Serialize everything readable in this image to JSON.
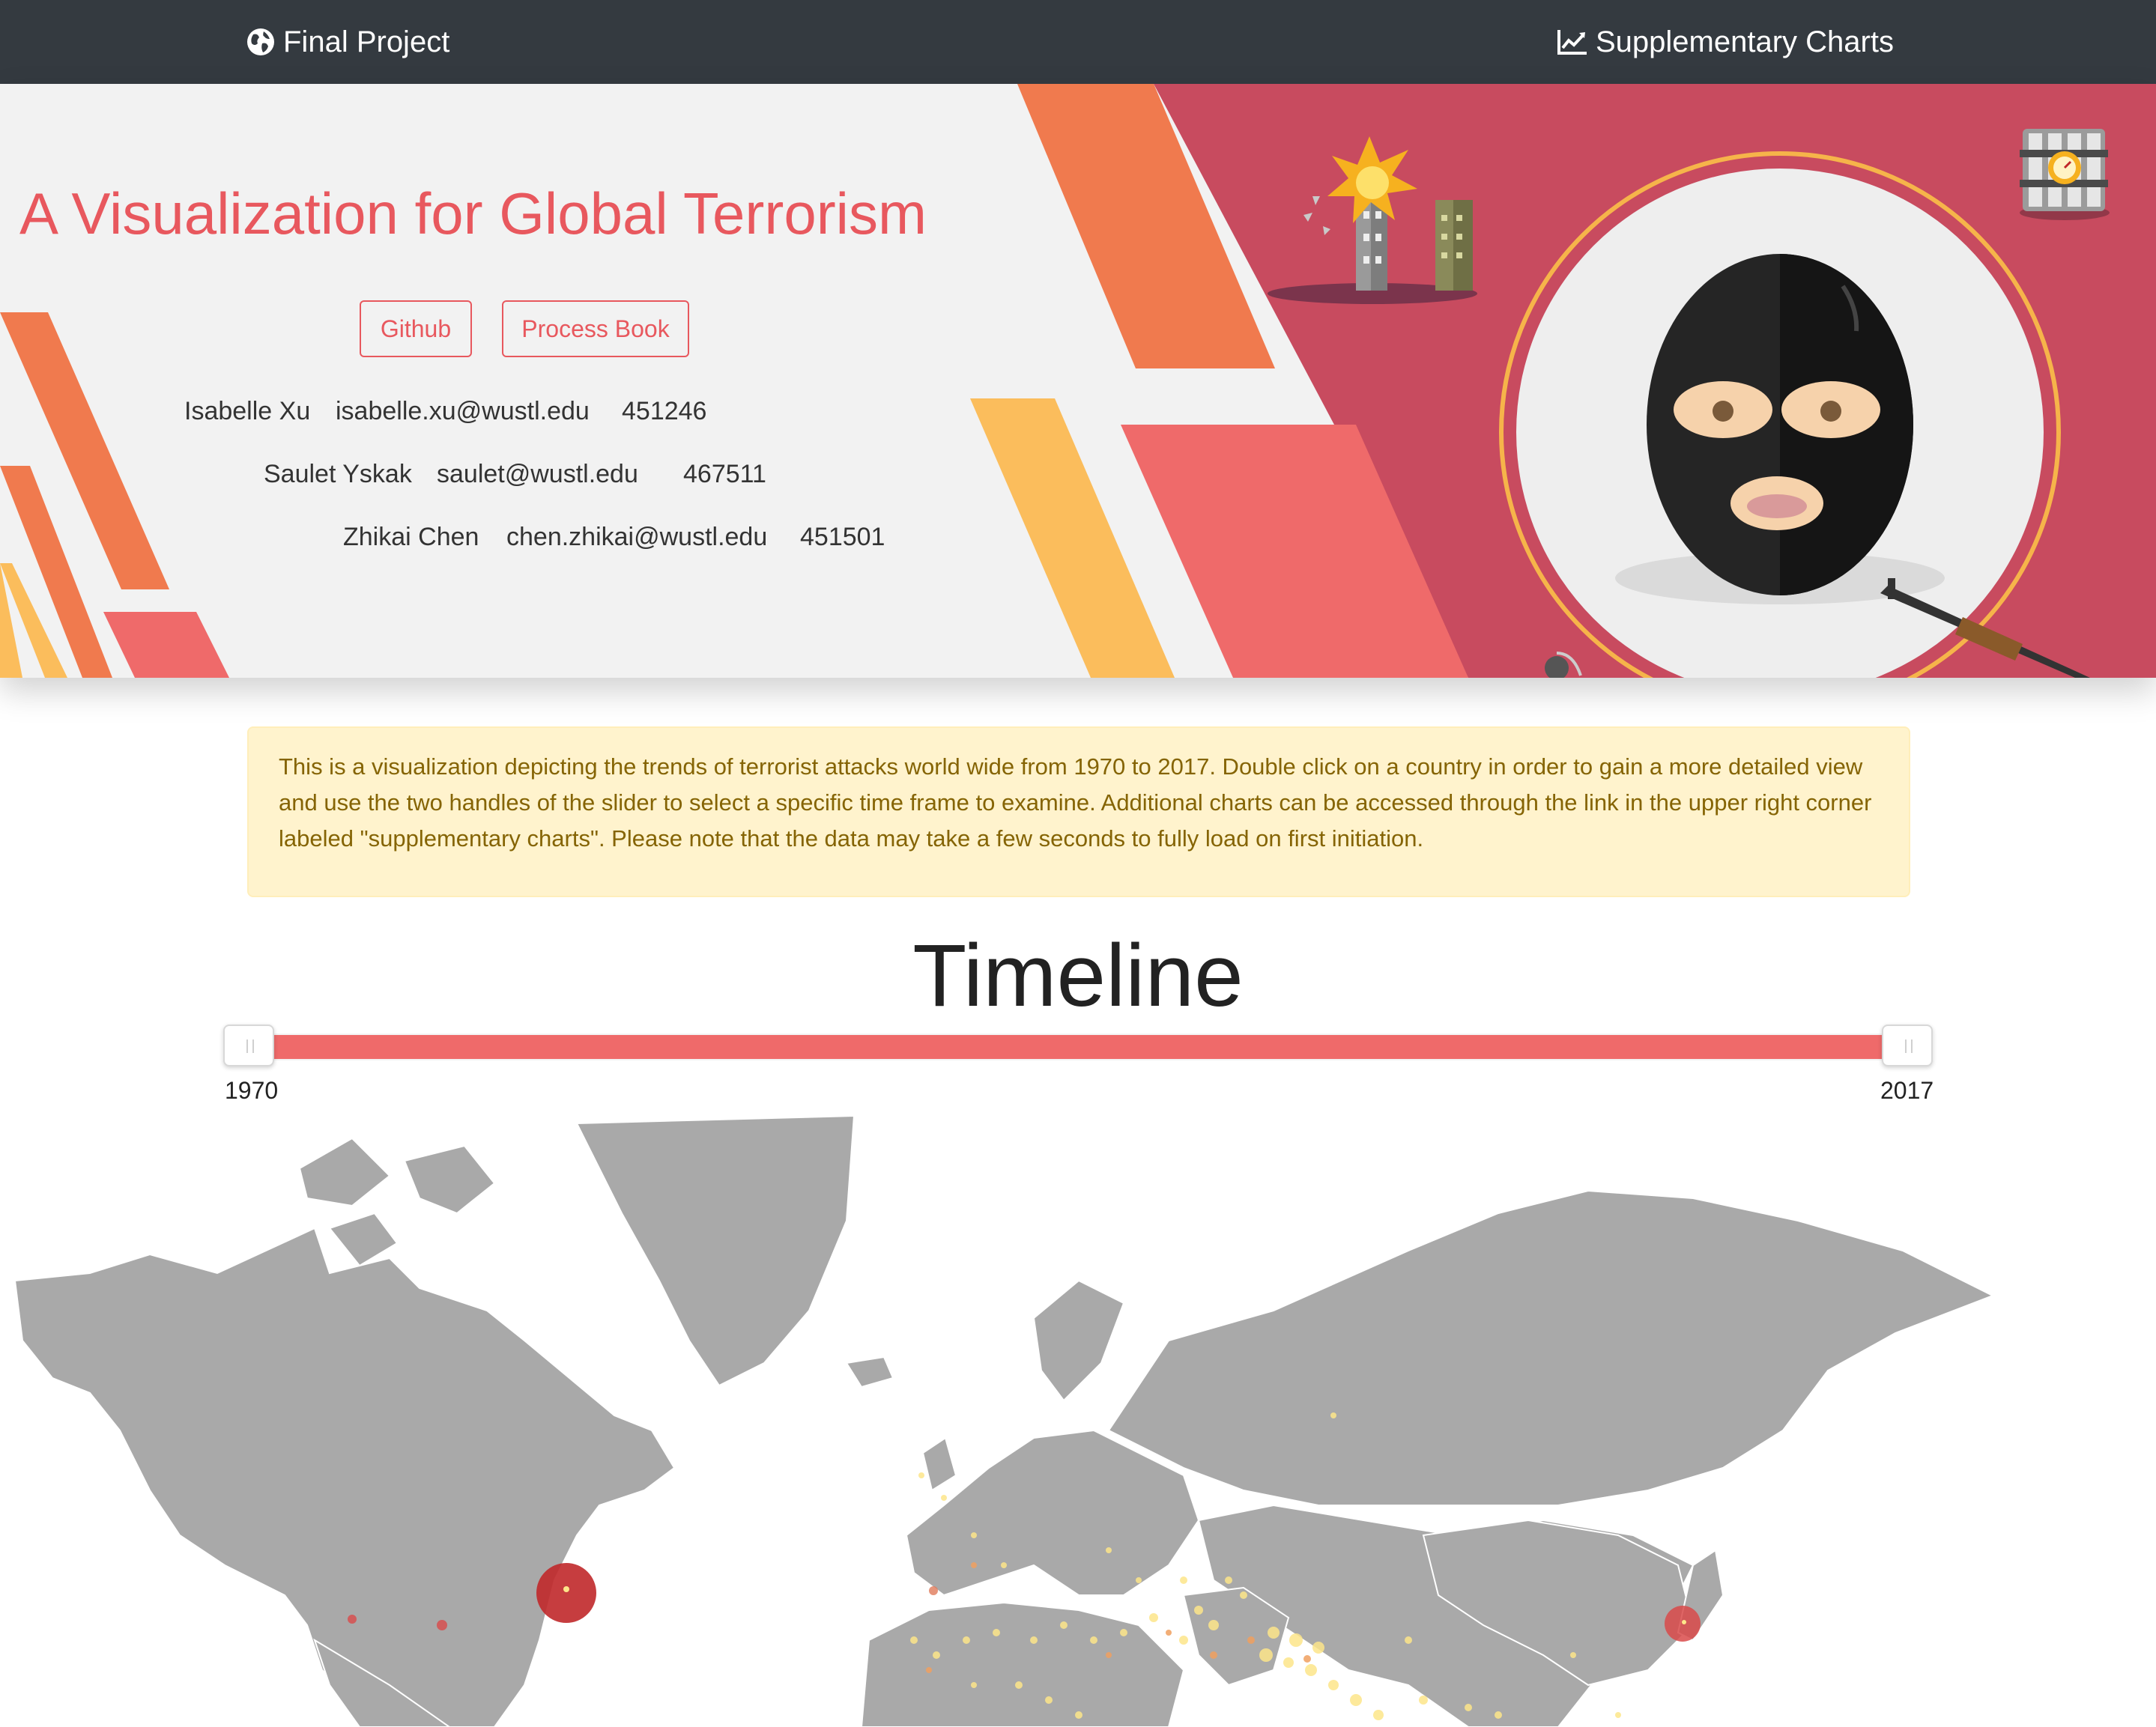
{
  "navbar": {
    "brand_label": "Final Project",
    "brand_icon": "globe-icon",
    "supplementary_label": "Supplementary Charts",
    "supplementary_icon": "line-chart-icon"
  },
  "hero": {
    "title": "A Visualization for Global Terrorism",
    "buttons": {
      "github": "Github",
      "process_book": "Process Book"
    },
    "authors": [
      {
        "name": "Isabelle Xu",
        "email": "isabelle.xu@wustl.edu",
        "id": "451246"
      },
      {
        "name": "Saulet Yskak",
        "email": "saulet@wustl.edu",
        "id": "467511"
      },
      {
        "name": "Zhikai Chen",
        "email": "chen.zhikai@wustl.edu",
        "id": "451501"
      }
    ]
  },
  "alert": {
    "text": "This is a visualization depicting the trends of terrorist attacks world wide from 1970 to 2017. Double click on a country in order to gain a more detailed view and use the two handles of the slider to select a specific time frame to examine. Additional charts can be accessed through the link in the upper right corner labeled \"supplementary charts\". Please note that the data may take a few seconds to fully load on first initiation."
  },
  "timeline": {
    "title": "Timeline",
    "min_label": "1970",
    "max_label": "2017",
    "range_start": 1970,
    "range_end": 2017
  },
  "colors": {
    "navbar": "#343a40",
    "accent": "#e8585e",
    "hero_red": "#c84b5f",
    "orange": "#f07a4e",
    "yellow": "#fbbd5c",
    "alert_bg": "#fff3cd",
    "alert_text": "#856404",
    "slider": "#ef6a6a",
    "land": "#a9a9a9",
    "attack_major": "#c0282a",
    "attack_minor": "#fde68a"
  }
}
